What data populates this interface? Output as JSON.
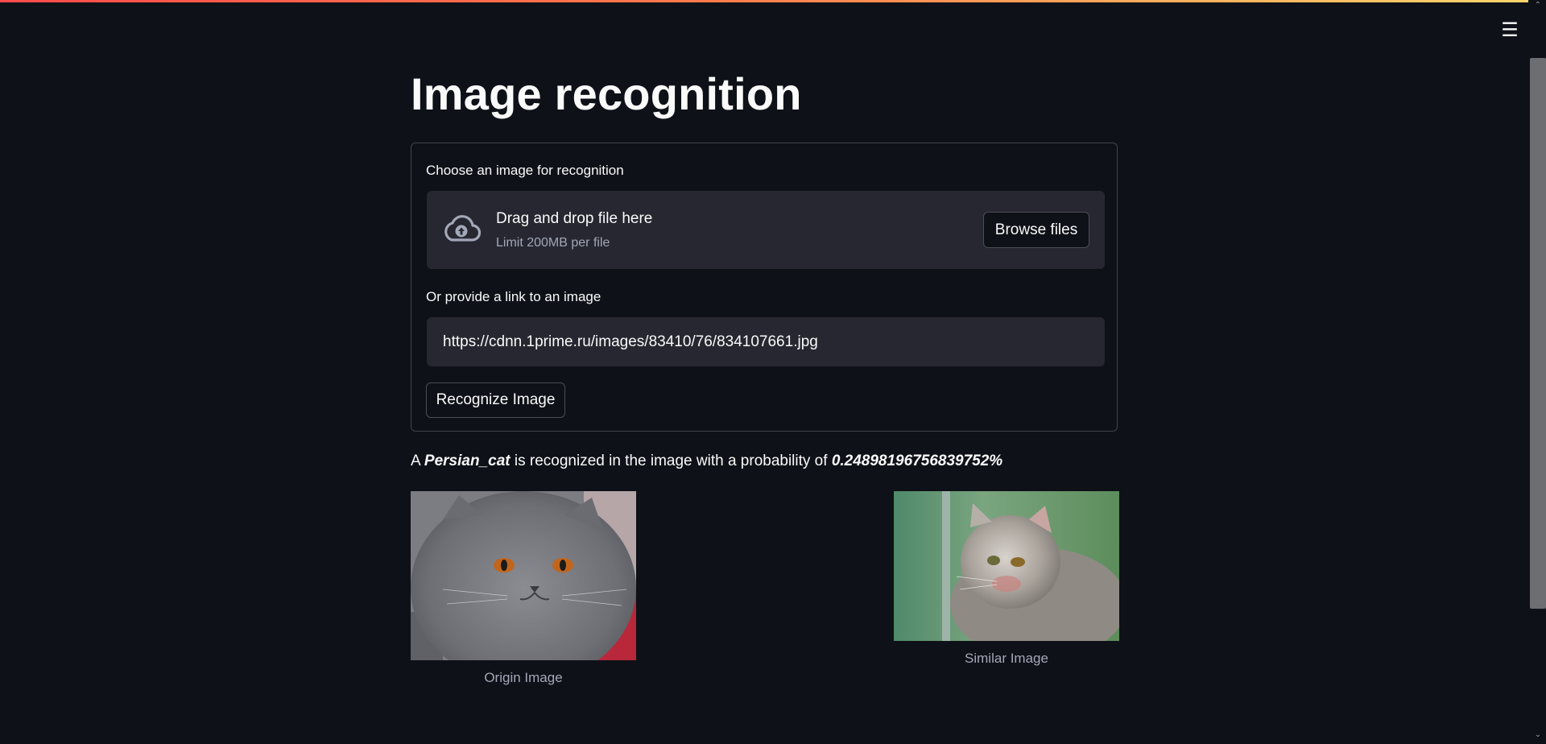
{
  "header": {
    "menu_icon": "hamburger-menu-icon"
  },
  "page": {
    "title": "Image recognition"
  },
  "uploader": {
    "label": "Choose an image for recognition",
    "icon": "cloud-upload-icon",
    "drop_title": "Drag and drop file here",
    "limit_text": "Limit 200MB per file",
    "browse_label": "Browse files"
  },
  "link": {
    "label": "Or provide a link to an image",
    "value": "https://cdnn.1prime.ru/images/83410/76/834107661.jpg"
  },
  "actions": {
    "recognize_label": "Recognize Image"
  },
  "result": {
    "prefix": "A ",
    "class_name": "Persian_cat",
    "middle": " is recognized in the image with a probability of ",
    "probability": "0.24898196756839752%"
  },
  "images": {
    "origin_caption": "Origin Image",
    "similar_caption": "Similar Image"
  },
  "colors": {
    "background": "#0e1117",
    "panel": "#262730",
    "border": "#41444c",
    "accent_gradient_start": "#ff4b4b",
    "accent_gradient_end": "#ffd76b"
  }
}
